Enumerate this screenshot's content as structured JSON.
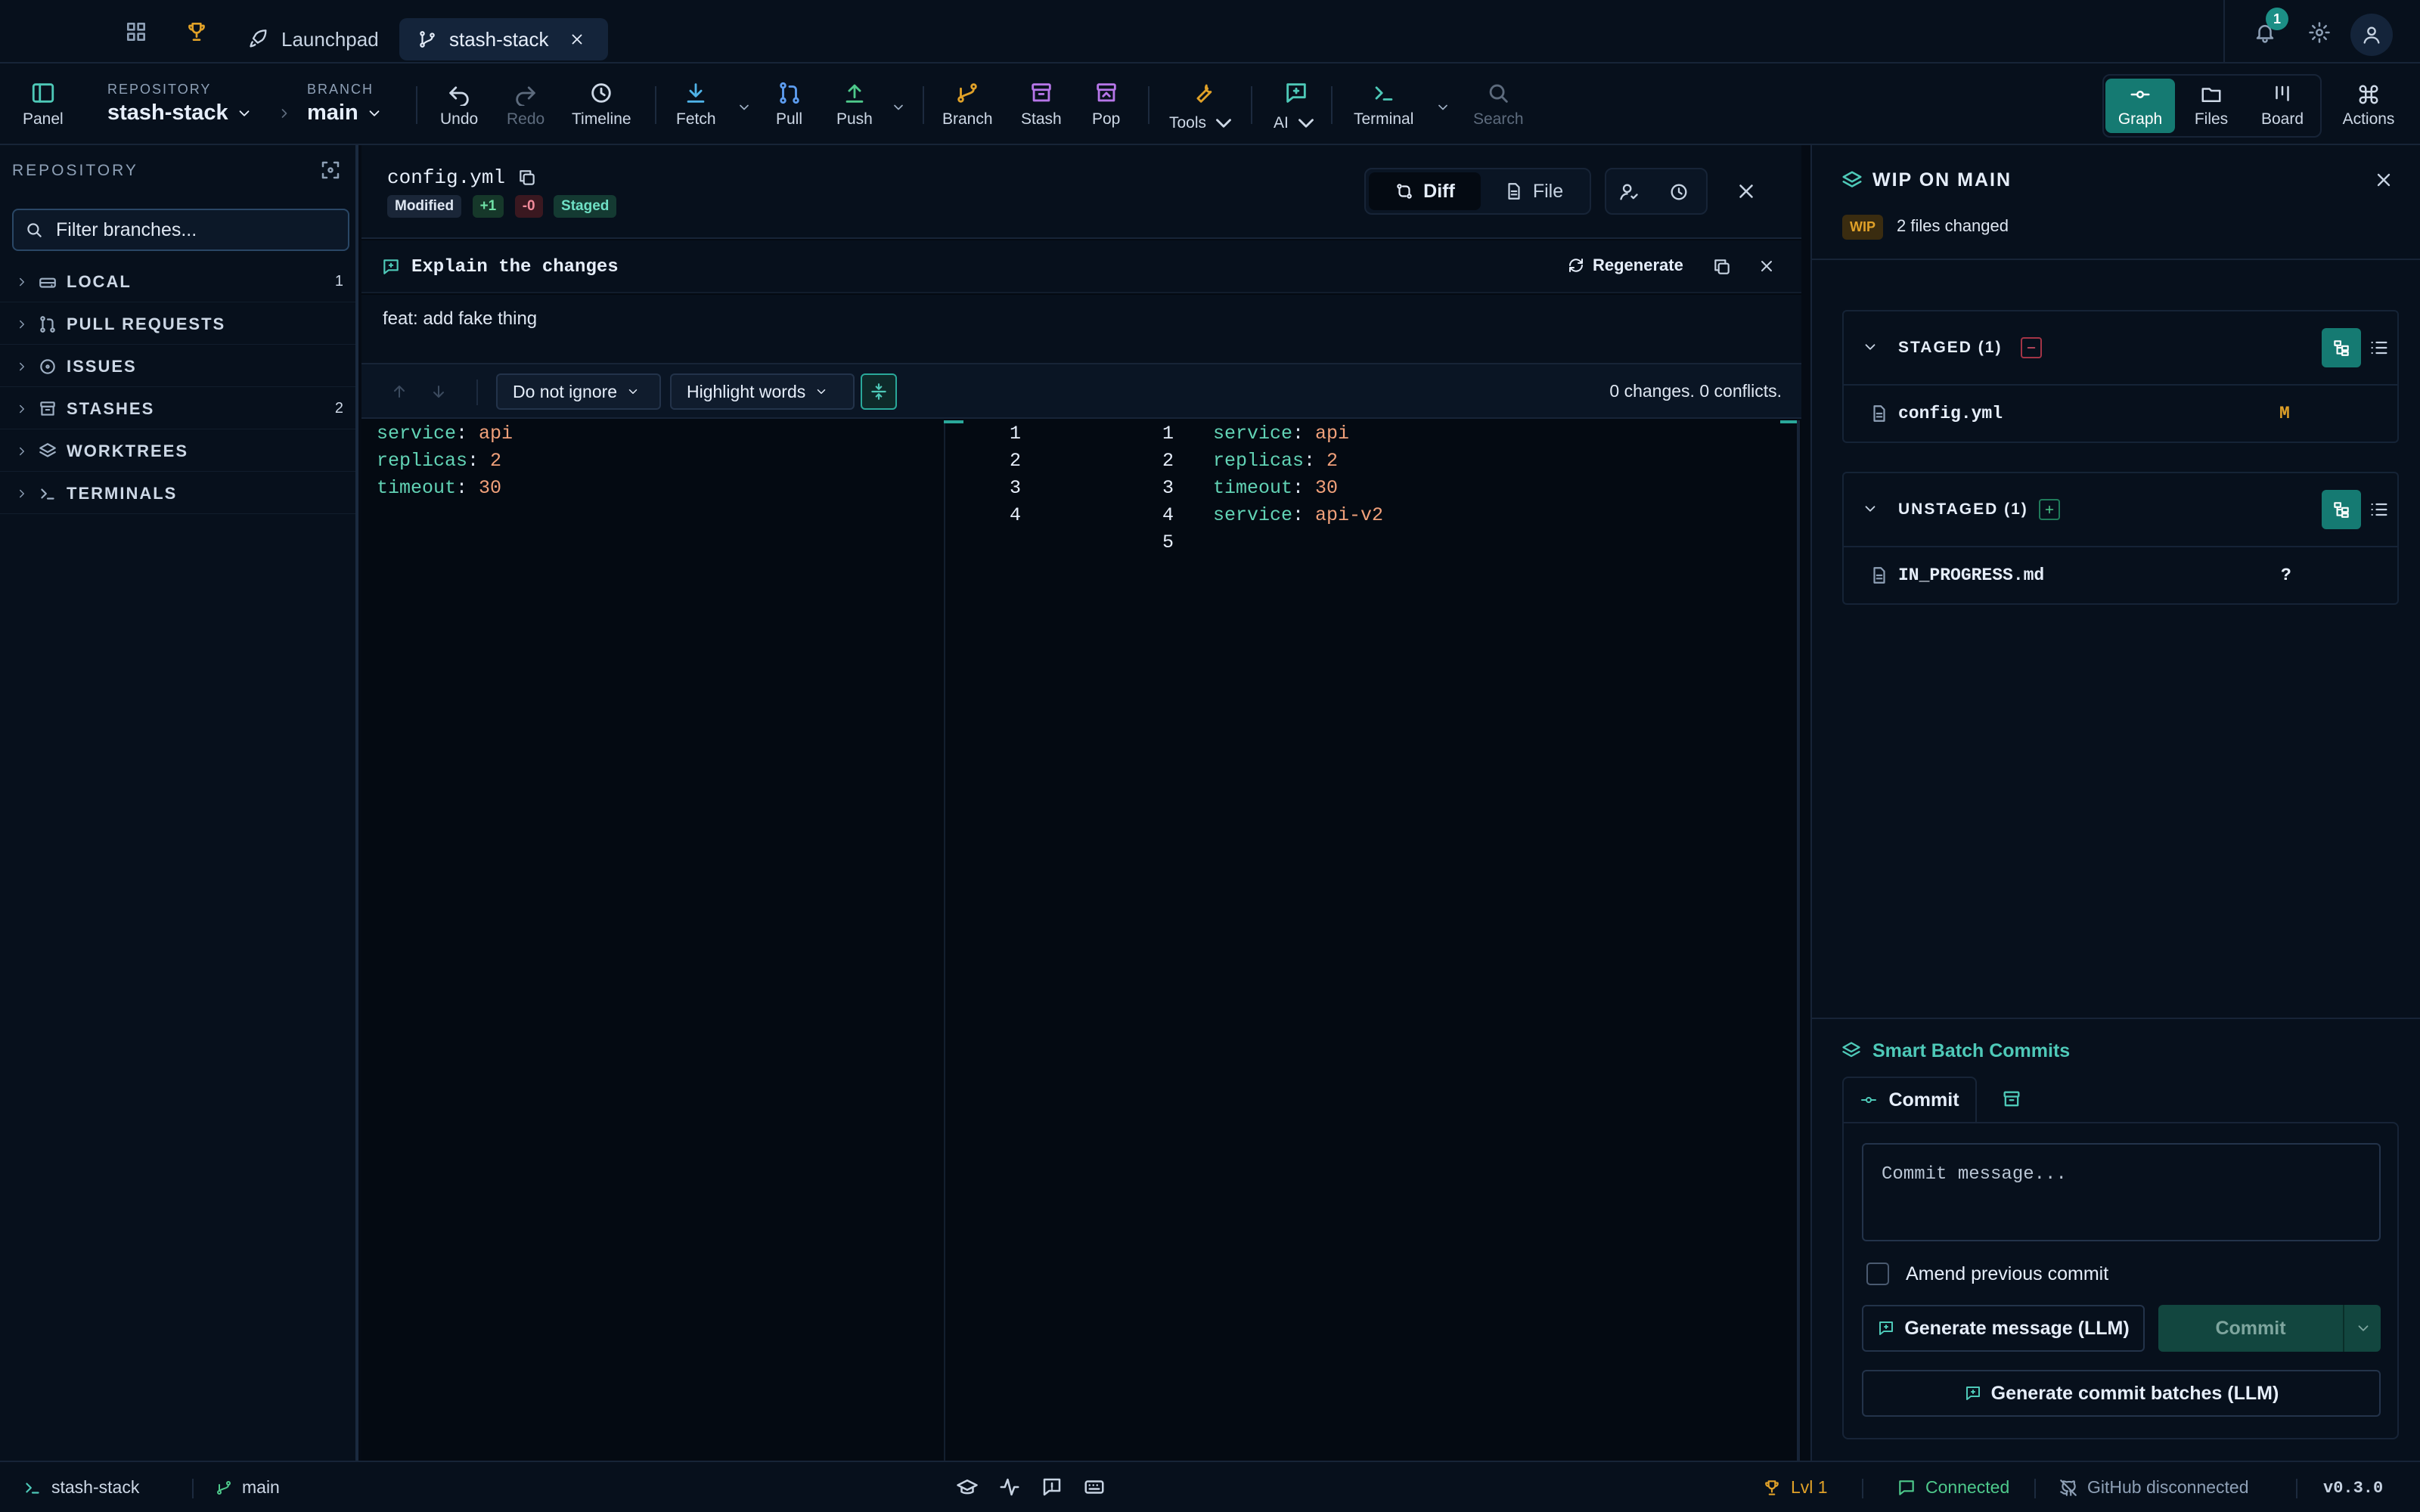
{
  "titlebar": {
    "tabs": [
      {
        "label": "Launchpad"
      },
      {
        "label": "stash-stack"
      }
    ],
    "notifications_count": "1"
  },
  "toolbar": {
    "panel_label": "Panel",
    "repository_caption": "REPOSITORY",
    "repository_name": "stash-stack",
    "branch_caption": "BRANCH",
    "branch_name": "main",
    "buttons": {
      "undo": "Undo",
      "redo": "Redo",
      "timeline": "Timeline",
      "fetch": "Fetch",
      "pull": "Pull",
      "push": "Push",
      "branch": "Branch",
      "stash": "Stash",
      "pop": "Pop",
      "tools": "Tools",
      "ai": "AI",
      "terminal": "Terminal",
      "search": "Search"
    },
    "views": {
      "graph": "Graph",
      "files": "Files",
      "board": "Board",
      "actions": "Actions"
    }
  },
  "sidebar": {
    "title": "REPOSITORY",
    "filter_placeholder": "Filter branches...",
    "items": [
      {
        "label": "LOCAL",
        "count": "1"
      },
      {
        "label": "PULL REQUESTS",
        "count": ""
      },
      {
        "label": "ISSUES",
        "count": ""
      },
      {
        "label": "STASHES",
        "count": "2"
      },
      {
        "label": "WORKTREES",
        "count": ""
      },
      {
        "label": "TERMINALS",
        "count": ""
      }
    ]
  },
  "file_header": {
    "filename": "config.yml",
    "status_badge": "Modified",
    "additions": "+1",
    "deletions": "-0",
    "staged_badge": "Staged",
    "diff_label": "Diff",
    "file_label": "File"
  },
  "explain": {
    "title": "Explain the changes",
    "regenerate_label": "Regenerate",
    "text": "feat: add fake thing"
  },
  "diff_toolbar": {
    "whitespace_select": "Do not ignore",
    "highlight_select": "Highlight words",
    "summary": "0 changes. 0 conflicts."
  },
  "diff": {
    "left_lines": [
      {
        "key": "service",
        "value": "api"
      },
      {
        "key": "replicas",
        "value": "2"
      },
      {
        "key": "timeout",
        "value": "30"
      }
    ],
    "left_numbers": [
      "1",
      "2",
      "3",
      "4"
    ],
    "right_numbers": [
      "1",
      "2",
      "3",
      "4",
      "5"
    ],
    "right_lines": [
      {
        "key": "service",
        "value": "api"
      },
      {
        "key": "replicas",
        "value": "2"
      },
      {
        "key": "timeout",
        "value": "30"
      },
      {
        "key": "service",
        "value": "api-v2"
      }
    ]
  },
  "right_panel": {
    "title": "WIP ON MAIN",
    "wip_badge": "WIP",
    "files_changed": "2 files changed",
    "staged": {
      "header": "STAGED (1)",
      "files": [
        {
          "name": "config.yml",
          "status": "M"
        }
      ]
    },
    "unstaged": {
      "header": "UNSTAGED (1)",
      "files": [
        {
          "name": "IN_PROGRESS.md",
          "status": "?"
        }
      ]
    },
    "smart_batch_title": "Smart Batch Commits",
    "commit_tab": "Commit",
    "commit_placeholder": "Commit message...",
    "amend_label": "Amend previous commit",
    "generate_message_label": "Generate message (LLM)",
    "commit_button": "Commit",
    "generate_batches_label": "Generate commit batches (LLM)"
  },
  "statusbar": {
    "repo": "stash-stack",
    "branch": "main",
    "level": "Lvl 1",
    "connection": "Connected",
    "github": "GitHub disconnected",
    "version": "v0.3.0"
  },
  "colors": {
    "accent": "#157a72",
    "background": "#050b14",
    "added_badge": "#1f5f3a",
    "deleted_badge": "#5a1f2a",
    "warn": "#e0a128"
  }
}
